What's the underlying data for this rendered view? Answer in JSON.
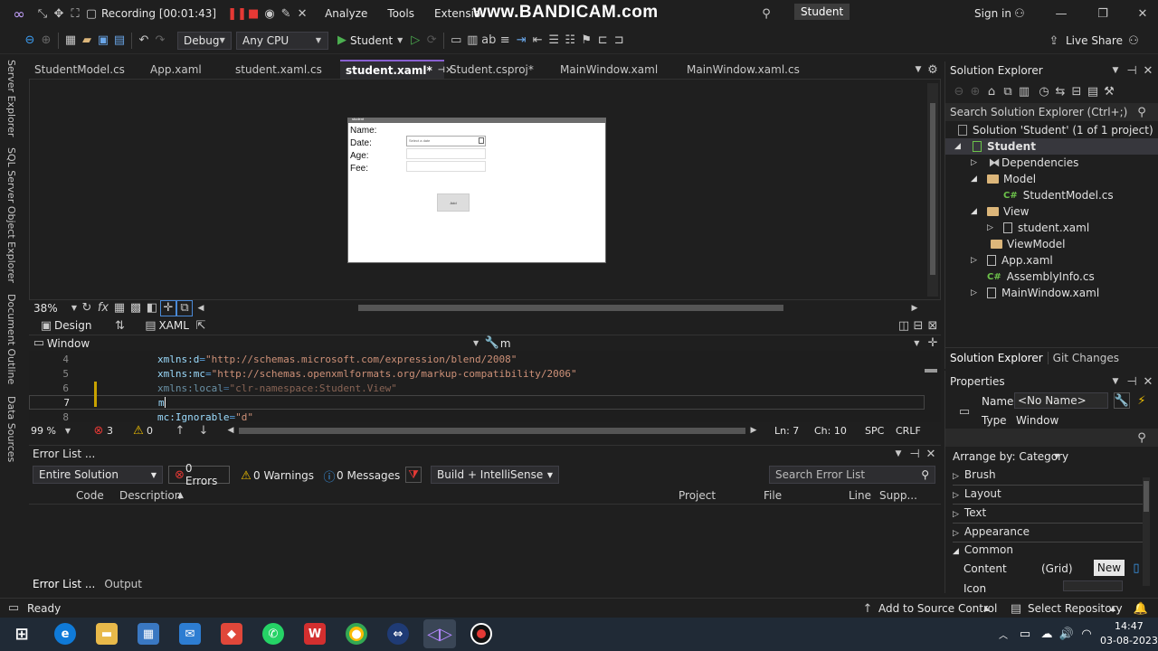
{
  "titlebar": {
    "recording_label": "Recording [00:01:43]",
    "menu": [
      "Analyze",
      "Tools",
      "Extensio"
    ],
    "watermark": "www.BANDICAM.com",
    "solution_name": "Student",
    "sign_in": "Sign in"
  },
  "toolbar": {
    "config": "Debug",
    "platform": "Any CPU",
    "run_target": "Student",
    "live_share": "Live Share"
  },
  "side_tabs": [
    "Server Explorer",
    "SQL Server Object Explorer",
    "Document Outline",
    "Data Sources"
  ],
  "doc_tabs": [
    {
      "label": "StudentModel.cs",
      "active": false
    },
    {
      "label": "App.xaml",
      "active": false
    },
    {
      "label": "student.xaml.cs",
      "active": false
    },
    {
      "label": "student.xaml*",
      "active": true
    },
    {
      "label": "Student.csproj*",
      "active": false
    },
    {
      "label": "MainWindow.xaml",
      "active": false
    },
    {
      "label": "MainWindow.xaml.cs",
      "active": false
    }
  ],
  "designer": {
    "window_title": "student",
    "labels": [
      "Name:",
      "Date:",
      "Age:",
      "Fee:"
    ],
    "date_placeholder": "Select a date",
    "button_label": "Add",
    "zoom": "38%"
  },
  "split": {
    "design_tab": "Design",
    "xaml_tab": "XAML"
  },
  "crumb": {
    "scope": "Window",
    "member": "m"
  },
  "code_lines": [
    {
      "num": "4",
      "attr": "xmlns:d",
      "value": "\"http://schemas.microsoft.com/expression/blend/2008\""
    },
    {
      "num": "5",
      "attr": "xmlns:mc",
      "value": "\"http://schemas.openxmlformats.org/markup-compatibility/2006\""
    },
    {
      "num": "6",
      "attr": "xmlns:local",
      "value": "\"clr-namespace:Student.View\""
    },
    {
      "num": "7",
      "attr": "m",
      "value": ""
    },
    {
      "num": "8",
      "attr": "mc:Ignorable",
      "value": "\"d\""
    }
  ],
  "editor_status": {
    "zoom": "99 %",
    "errors": "3",
    "warnings": "0",
    "line": "Ln: 7",
    "col": "Ch: 10",
    "spc": "SPC",
    "eol": "CRLF"
  },
  "error_list": {
    "title": "Error List ...",
    "scope": "Entire Solution",
    "errors": "0 Errors",
    "warnings": "0 Warnings",
    "messages": "0 Messages",
    "build": "Build + IntelliSense",
    "search": "Search Error List",
    "columns": [
      "Code",
      "Description",
      "Project",
      "File",
      "Line",
      "Supp..."
    ]
  },
  "bottom_tabs": [
    "Error List ...",
    "Output"
  ],
  "solution_explorer": {
    "title": "Solution Explorer",
    "search": "Search Solution Explorer (Ctrl+;)",
    "solution": "Solution 'Student' (1 of 1 project)",
    "project": "Student",
    "nodes": [
      "Dependencies",
      "Model",
      "StudentModel.cs",
      "View",
      "student.xaml",
      "ViewModel",
      "App.xaml",
      "AssemblyInfo.cs",
      "MainWindow.xaml"
    ],
    "tabs": [
      "Solution Explorer",
      "Git Changes"
    ]
  },
  "properties": {
    "title": "Properties",
    "name_label": "Name",
    "name_value": "<No Name>",
    "type_label": "Type",
    "type_value": "Window",
    "arrange": "Arrange by: Category",
    "categories": [
      "Brush",
      "Layout",
      "Text",
      "Appearance",
      "Common"
    ],
    "content_label": "Content",
    "content_value": "(Grid)",
    "new_button": "New",
    "icon_label": "Icon"
  },
  "statusbar": {
    "ready": "Ready",
    "source_control": "Add to Source Control",
    "repository": "Select Repository"
  },
  "taskbar": {
    "time": "14:47",
    "date": "03-08-2023"
  },
  "colors": {
    "accent": "#8860d0",
    "vs_purple": "#9b6fd6",
    "record_red": "#e53935"
  }
}
